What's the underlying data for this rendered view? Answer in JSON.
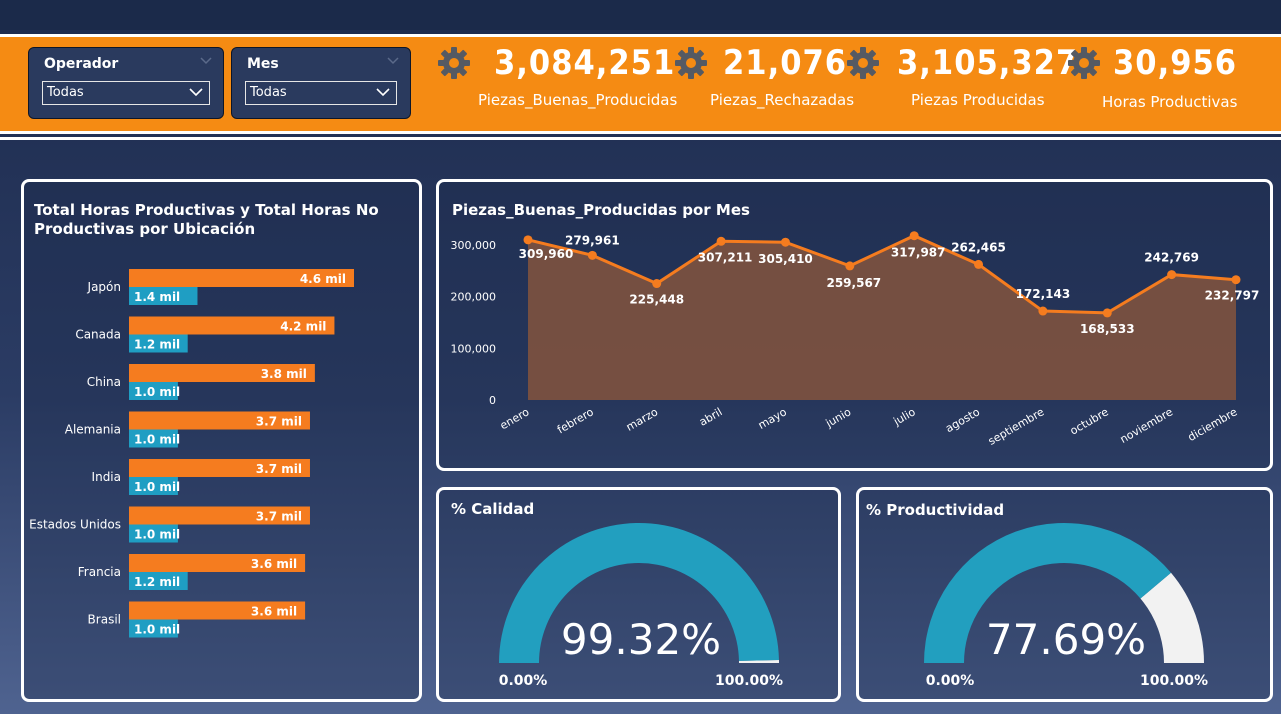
{
  "slicers": [
    {
      "title": "Operador",
      "value": "Todas"
    },
    {
      "title": "Mes",
      "value": "Todas"
    }
  ],
  "kpis": [
    {
      "value": "3,084,251",
      "label": "Piezas_Buenas_Producidas"
    },
    {
      "value": "21,076",
      "label": "Piezas_Rechazadas"
    },
    {
      "value": "3,105,327",
      "label": "Piezas Producidas"
    },
    {
      "value": "30,956",
      "label": "Horas Productivas"
    }
  ],
  "hbar": {
    "title": "Total Horas Productivas y Total Horas No Productivas por Ubicación",
    "colors": {
      "productivas": "#f57c1f",
      "no_productivas": "#1f9ec3"
    }
  },
  "line": {
    "title": "Piezas_Buenas_Producidas por Mes",
    "colors": {
      "line": "#f57c1f",
      "area": "#7a5140"
    }
  },
  "gauge_calidad": {
    "title": "% Calidad",
    "value": "99.32%",
    "min": "0.00%",
    "max": "100.00%",
    "colors": {
      "fill": "#229fbf",
      "rest": "#f2f2f2"
    }
  },
  "gauge_productividad": {
    "title": "% Productividad",
    "value": "77.69%",
    "min": "0.00%",
    "max": "100.00%",
    "colors": {
      "fill": "#229fbf",
      "rest": "#f2f2f2"
    }
  },
  "chart_data": [
    {
      "type": "bar",
      "orientation": "horizontal",
      "title": "Total Horas Productivas y Total Horas No Productivas por Ubicación",
      "categories": [
        "Japón",
        "Canada",
        "China",
        "Alemania",
        "India",
        "Estados Unidos",
        "Francia",
        "Brasil"
      ],
      "series": [
        {
          "values": [
            4.6,
            4.2,
            3.8,
            3.7,
            3.7,
            3.7,
            3.6,
            3.6
          ],
          "labels": [
            "4.6 mil",
            "4.2 mil",
            "3.8 mil",
            "3.7 mil",
            "3.7 mil",
            "3.7 mil",
            "3.6 mil",
            "3.6 mil"
          ]
        },
        {
          "values": [
            1.4,
            1.2,
            1.0,
            1.0,
            1.0,
            1.0,
            1.2,
            1.0
          ],
          "labels": [
            "1.4 mil",
            "1.2 mil",
            "1.0 mil",
            "1.0 mil",
            "1.0 mil",
            "1.0 mil",
            "1.2 mil",
            "1.0 mil"
          ]
        }
      ],
      "xlim": [
        0,
        5
      ]
    },
    {
      "type": "area",
      "title": "Piezas_Buenas_Producidas por Mes",
      "x": [
        "enero",
        "febrero",
        "marzo",
        "abril",
        "mayo",
        "junio",
        "julio",
        "agosto",
        "septiembre",
        "octubre",
        "noviembre",
        "diciembre"
      ],
      "values": [
        309960,
        279961,
        225448,
        307211,
        305410,
        259567,
        317987,
        262465,
        172143,
        168533,
        242769,
        232797
      ],
      "labels": [
        "309,960",
        "279,961",
        "225,448",
        "307,211",
        "305,410",
        "259,567",
        "317,987",
        "262,465",
        "172,143",
        "168,533",
        "242,769",
        "232,797"
      ],
      "yticks": [
        "300,000",
        "200,000",
        "100,000",
        "0"
      ],
      "ylim": [
        0,
        300000
      ],
      "grid": false
    }
  ]
}
